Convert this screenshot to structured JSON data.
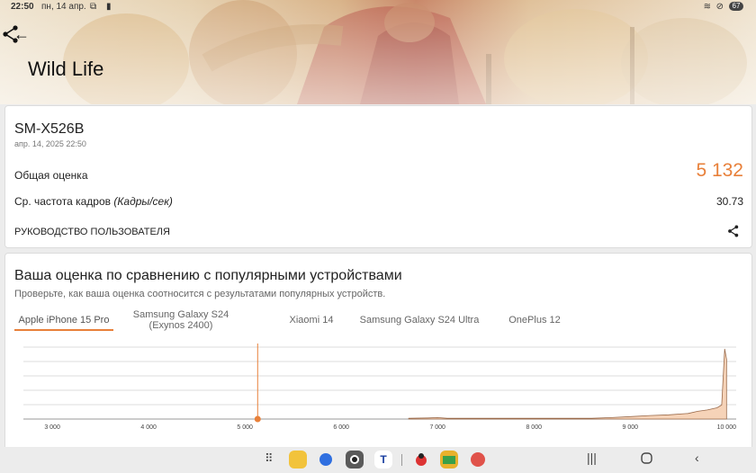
{
  "status": {
    "time": "22:50",
    "date": "пн, 14 апр.",
    "battery": "67"
  },
  "header": {
    "title": "Wild Life"
  },
  "result": {
    "device": "SM-X526B",
    "date": "апр. 14, 2025 22:50",
    "score_label": "Общая оценка",
    "score_value": "5 132",
    "fps_label": "Ср. частота кадров",
    "fps_unit": "(Кадры/сек)",
    "fps_value": "30.73",
    "guide_label": "РУКОВОДСТВО ПОЛЬЗОВАТЕЛЯ"
  },
  "comparison": {
    "title": "Ваша оценка по сравнению с популярными устройствами",
    "subtitle": "Проверьте, как ваша оценка соотносится с результатами популярных устройств.",
    "tabs": [
      {
        "label": "Apple iPhone 15 Pro"
      },
      {
        "label": "Samsung Galaxy S24 (Exynos 2400)"
      },
      {
        "label": "Xiaomi 14"
      },
      {
        "label": "Samsung Galaxy S24 Ultra"
      },
      {
        "label": "OnePlus 12"
      }
    ],
    "active_tab": 0
  },
  "chart_data": {
    "type": "area",
    "xticks": [
      "3 000",
      "4 000",
      "5 000",
      "6 000",
      "7 000",
      "8 000",
      "9 000",
      "10 000"
    ],
    "xlim": [
      2700,
      10100
    ],
    "marker_score": 5132,
    "distribution": [
      [
        6700,
        0.01
      ],
      [
        6900,
        0.015
      ],
      [
        7000,
        0.02
      ],
      [
        7100,
        0.01
      ],
      [
        8600,
        0.01
      ],
      [
        8800,
        0.02
      ],
      [
        9000,
        0.035
      ],
      [
        9200,
        0.05
      ],
      [
        9400,
        0.06
      ],
      [
        9600,
        0.08
      ],
      [
        9700,
        0.11
      ],
      [
        9800,
        0.13
      ],
      [
        9900,
        0.16
      ],
      [
        9950,
        0.2
      ],
      [
        9980,
        1.0
      ],
      [
        10000,
        0.85
      ]
    ],
    "color": "#e8803a"
  },
  "colors": {
    "accent": "#e8803a"
  },
  "navbar": {
    "apps": [
      "apps-grid-icon",
      "notes-icon",
      "messages-icon",
      "camera-icon",
      "tasks-icon",
      "ladybug-icon",
      "folder-icon",
      "game-icon"
    ]
  }
}
